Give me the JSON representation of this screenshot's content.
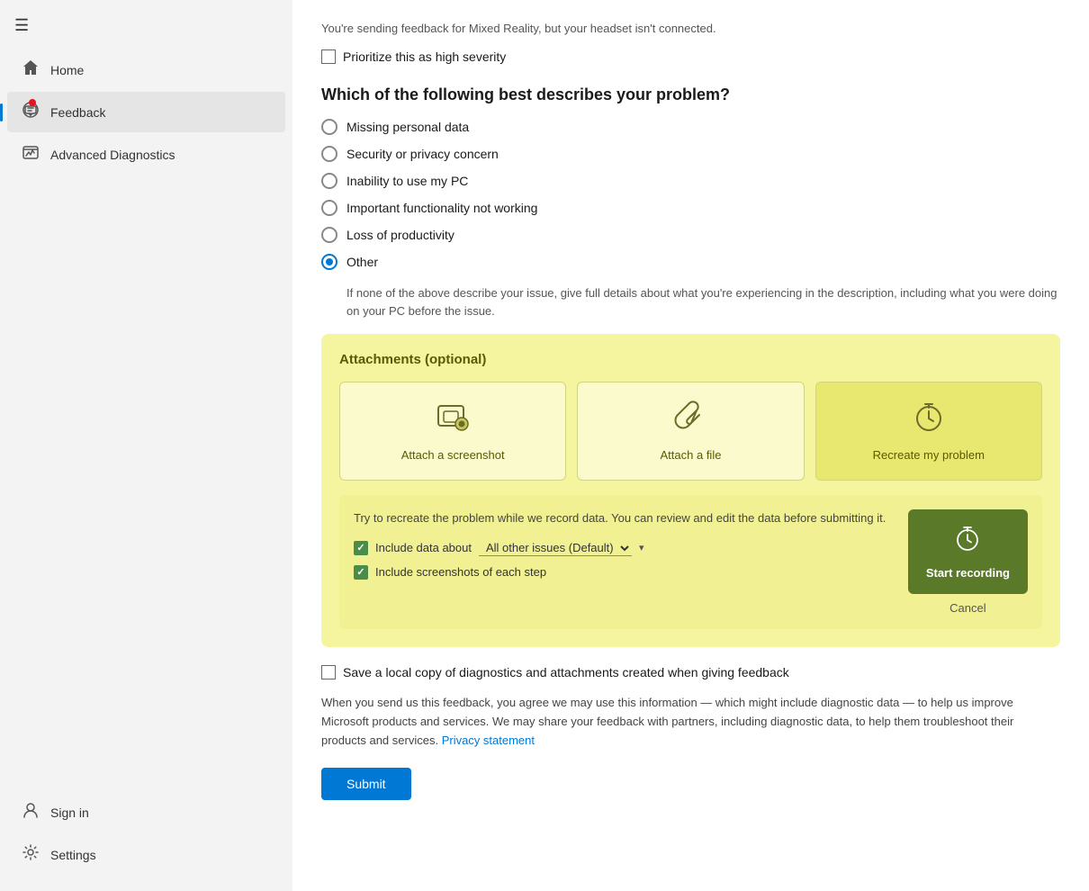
{
  "sidebar": {
    "hamburger_icon": "☰",
    "items": [
      {
        "id": "home",
        "label": "Home",
        "icon": "home"
      },
      {
        "id": "feedback",
        "label": "Feedback",
        "icon": "feedback",
        "active": true
      },
      {
        "id": "advanced-diagnostics",
        "label": "Advanced Diagnostics",
        "icon": "diagnostics"
      }
    ],
    "bottom_items": [
      {
        "id": "sign-in",
        "label": "Sign in",
        "icon": "account"
      },
      {
        "id": "settings",
        "label": "Settings",
        "icon": "settings"
      }
    ]
  },
  "main": {
    "info_text": "You're sending feedback for Mixed Reality, but your headset isn't connected.",
    "priority_checkbox_label": "Prioritize this as high severity",
    "section_title": "Which of the following best describes your problem?",
    "radio_options": [
      {
        "id": "missing-personal-data",
        "label": "Missing personal data",
        "selected": false
      },
      {
        "id": "security-privacy",
        "label": "Security or privacy concern",
        "selected": false
      },
      {
        "id": "inability-to-use",
        "label": "Inability to use my PC",
        "selected": false
      },
      {
        "id": "important-functionality",
        "label": "Important functionality not working",
        "selected": false
      },
      {
        "id": "loss-of-productivity",
        "label": "Loss of productivity",
        "selected": false
      },
      {
        "id": "other",
        "label": "Other",
        "selected": true
      }
    ],
    "other_description": "If none of the above describe your issue, give full details about what you're experiencing in the description, including what you were doing on your PC before the issue.",
    "attachments": {
      "title": "Attachments (optional)",
      "buttons": [
        {
          "id": "attach-screenshot",
          "label": "Attach a screenshot",
          "icon": "screenshot"
        },
        {
          "id": "attach-file",
          "label": "Attach a file",
          "icon": "paperclip"
        },
        {
          "id": "recreate-problem",
          "label": "Recreate my problem",
          "icon": "timer",
          "active": true
        }
      ],
      "recreate_desc": "Try to recreate the problem while we record data. You can review and edit the data before submitting it.",
      "checkbox1_label": "Include data about",
      "dropdown_value": "All other issues (Default)",
      "checkbox2_label": "Include screenshots of each step",
      "start_recording_label": "Start recording",
      "cancel_label": "Cancel"
    },
    "save_local_label": "Save a local copy of diagnostics and attachments created when giving feedback",
    "legal_text": "When you send us this feedback, you agree we may use this information — which might include diagnostic data — to help us improve Microsoft products and services. We may share your feedback with partners, including diagnostic data, to help them troubleshoot their products and services.",
    "privacy_link_label": "Privacy statement",
    "submit_label": "Submit"
  }
}
